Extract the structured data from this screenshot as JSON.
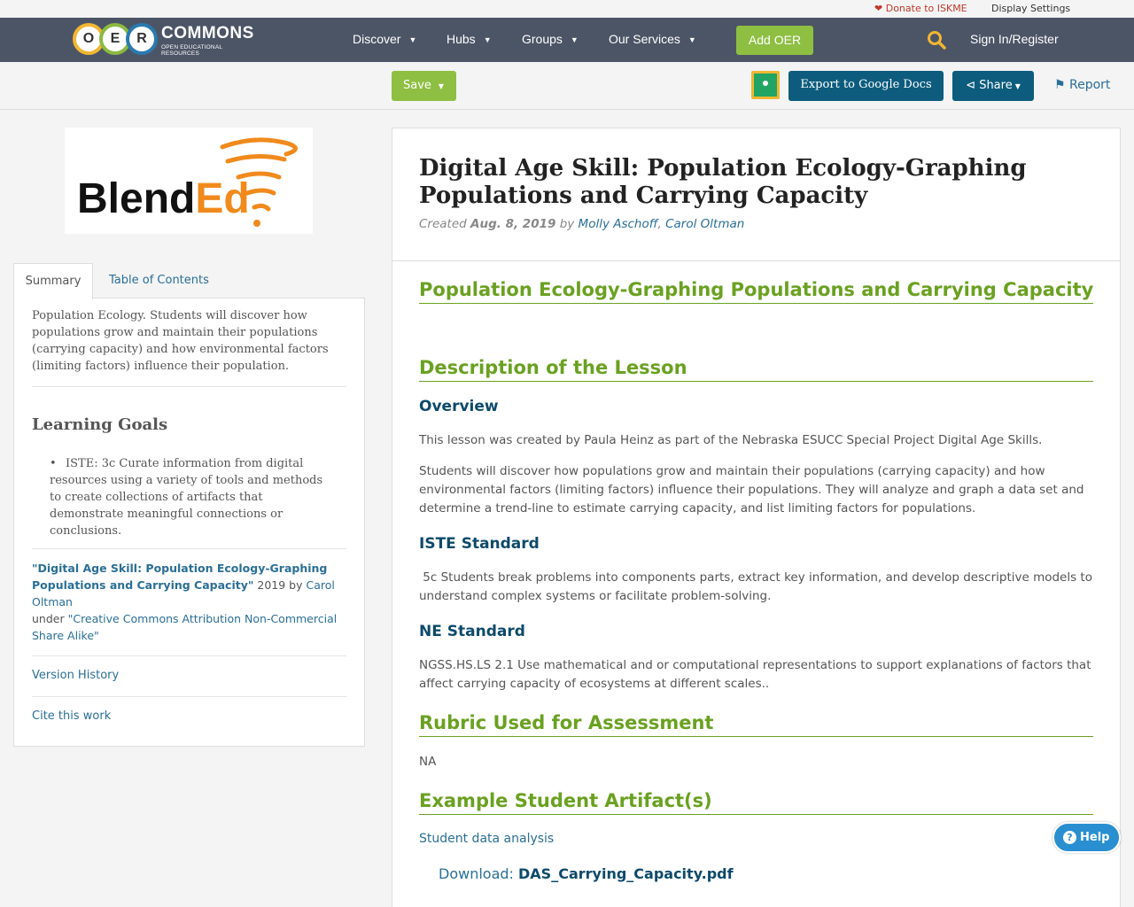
{
  "utility": {
    "donate": "Donate to ISKME",
    "display_settings": "Display Settings"
  },
  "nav": {
    "logo_letters": [
      "O",
      "E",
      "R"
    ],
    "logo_title": "COMMONS",
    "logo_sub": "OPEN EDUCATIONAL RESOURCES",
    "items": [
      "Discover",
      "Hubs",
      "Groups",
      "Our Services"
    ],
    "add_oer": "Add OER",
    "sign_in": "Sign In/Register"
  },
  "actions": {
    "save": "Save",
    "export": "Export to Google Docs",
    "share": "Share",
    "report": "Report"
  },
  "sidebar": {
    "logo_text": "BlendEd",
    "tabs": [
      "Summary",
      "Table of Contents"
    ],
    "summary": "Population Ecology. Students will discover how populations grow and maintain their populations (carrying capacity) and how environmental factors (limiting factors) influence their population.",
    "learning_goals_heading": "Learning Goals",
    "learning_goals": [
      "ISTE: 3c Curate information from digital resources using a variety of tools and methods to create collections of artifacts that demonstrate meaningful connections or conclusions."
    ],
    "attribution": {
      "title": "\"Digital Age Skill: Population Ecology-Graphing Populations and Carrying Capacity\"",
      "year_by": " 2019 by ",
      "author": "Carol Oltman",
      "under": "under ",
      "license": "\"Creative Commons Attribution Non-Commercial Share Alike\""
    },
    "version_history": "Version History",
    "cite": "Cite this work"
  },
  "content": {
    "title": "Digital Age Skill: Population Ecology-Graphing Populations and Carrying Capacity",
    "created_label": "Created",
    "created_date": "Aug. 8, 2019",
    "by": "by",
    "author1": "Molly Aschoff",
    "author2": "Carol Oltman",
    "sec1": "Population Ecology-Graphing Populations and Carrying Capacity",
    "sec2": "Description of the Lesson",
    "overview": "Overview",
    "overview_p1": "This lesson was created by Paula Heinz as part of the Nebraska ESUCC Special Project Digital Age Skills.",
    "overview_p2": "Students will discover how populations grow and maintain their populations (carrying capacity) and how environmental factors (limiting factors) influence their populations. They will analyze and graph a data set and determine a trend-line to estimate carrying capacity, and list limiting factors for populations.",
    "iste": "ISTE Standard",
    "iste_p": " 5c Students break problems into components parts, extract key information, and develop descriptive models to understand complex systems or facilitate problem-solving.",
    "ne": "NE Standard",
    "ne_p": "NGSS.HS.LS 2.1 Use mathematical and or computational representations to support explanations of factors that affect carrying capacity of ecosystems at different scales..",
    "sec3": "Rubric Used for Assessment",
    "rubric_p": "NA",
    "sec4": "Example Student Artifact(s)",
    "student_link": "Student data analysis",
    "download_label": "Download:",
    "download_file": "DAS_Carrying_Capacity.pdf"
  },
  "help": "Help"
}
